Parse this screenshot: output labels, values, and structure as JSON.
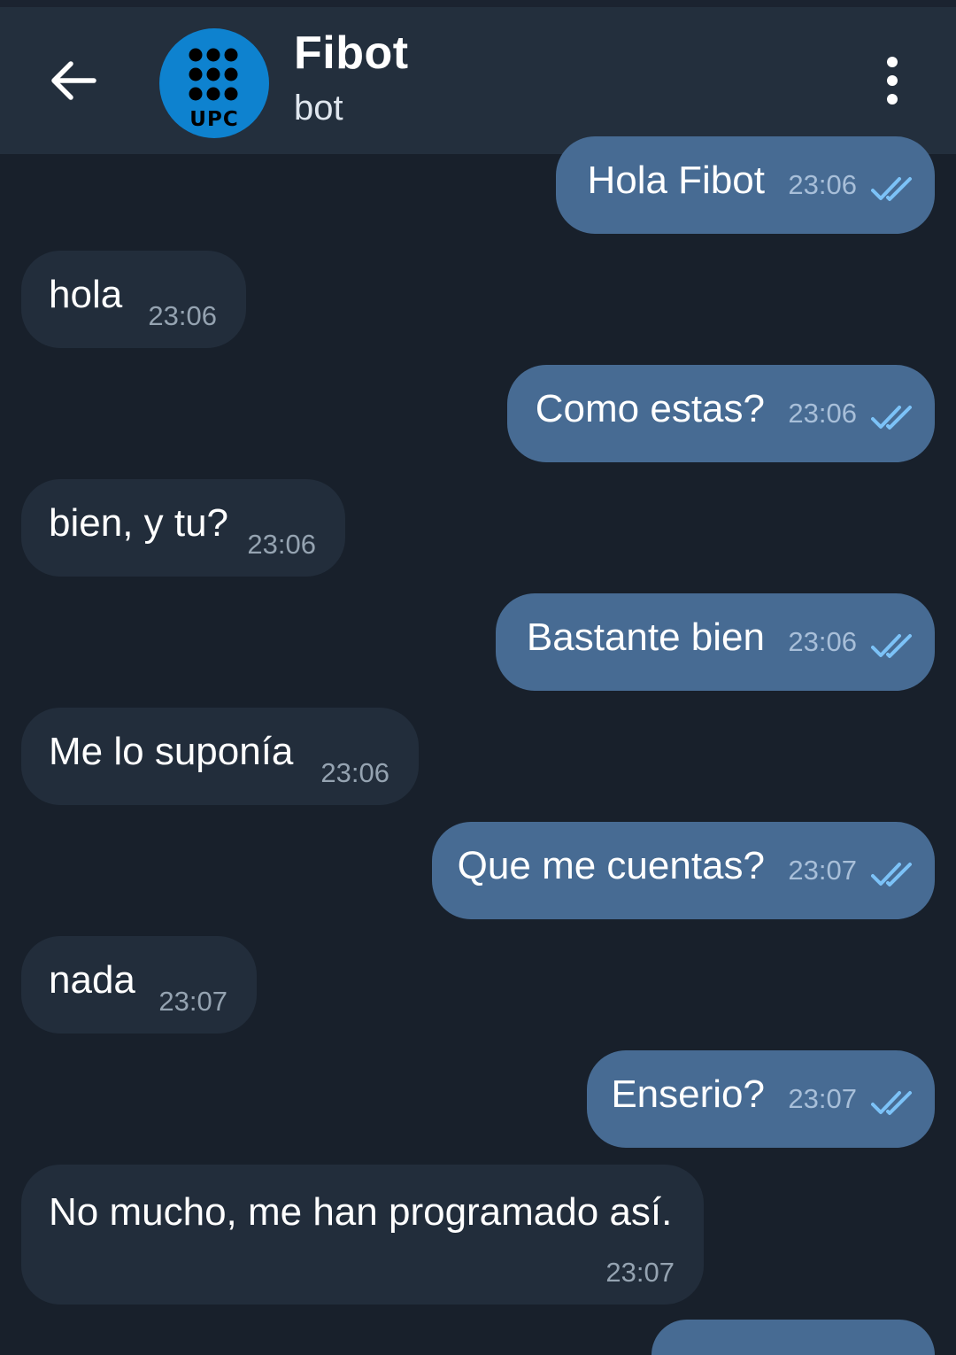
{
  "header": {
    "title": "Fibot",
    "subtitle": "bot",
    "avatar_text": "UPC",
    "back_icon": "arrow-left-icon",
    "menu_icon": "more-vertical-icon"
  },
  "colors": {
    "background": "#18202b",
    "header": "#232f3d",
    "outgoing_bubble": "#476b93",
    "incoming_bubble": "#222d3b",
    "read_check": "#7cc2f7",
    "avatar": "#0e82cf"
  },
  "messages": [
    {
      "direction": "out",
      "text": "Hola Fibot",
      "time": "23:06",
      "status": "read"
    },
    {
      "direction": "in",
      "text": "hola",
      "time": "23:06"
    },
    {
      "direction": "out",
      "text": "Como estas?",
      "time": "23:06",
      "status": "read"
    },
    {
      "direction": "in",
      "text": "bien, y tu?",
      "time": "23:06"
    },
    {
      "direction": "out",
      "text": "Bastante bien",
      "time": "23:06",
      "status": "read"
    },
    {
      "direction": "in",
      "text": "Me lo suponía",
      "time": "23:06"
    },
    {
      "direction": "out",
      "text": "Que me cuentas?",
      "time": "23:07",
      "status": "read"
    },
    {
      "direction": "in",
      "text": "nada",
      "time": "23:07"
    },
    {
      "direction": "out",
      "text": "Enserio?",
      "time": "23:07",
      "status": "read"
    },
    {
      "direction": "in",
      "text": "No mucho, me han programado así.",
      "time": "23:07"
    }
  ]
}
